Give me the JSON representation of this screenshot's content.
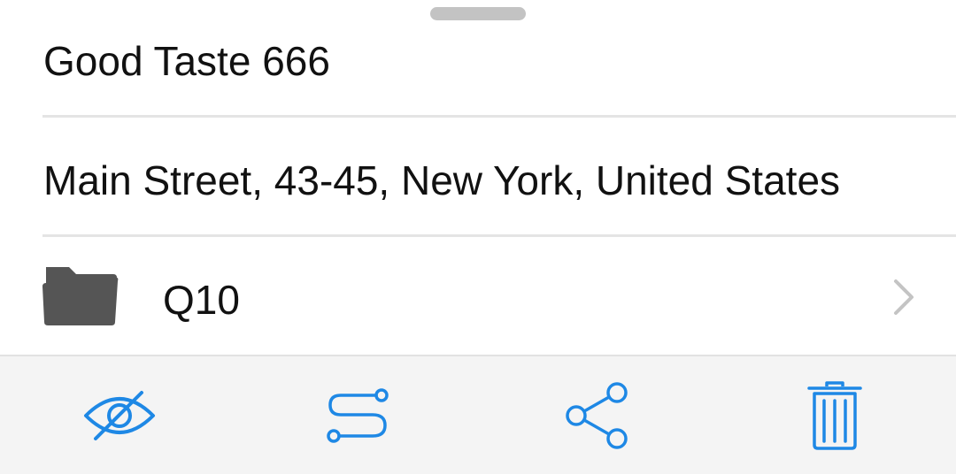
{
  "place": {
    "name": "Good Taste 666",
    "address": "Main Street, 43-45, New York, United States"
  },
  "folder": {
    "icon": "folder-icon",
    "label": "Q10"
  },
  "toolbar": {
    "accent_color": "#1e88e5",
    "actions": [
      {
        "icon": "eye-off-icon",
        "action": "hide"
      },
      {
        "icon": "route-icon",
        "action": "route"
      },
      {
        "icon": "share-icon",
        "action": "share"
      },
      {
        "icon": "trash-icon",
        "action": "delete"
      }
    ]
  }
}
